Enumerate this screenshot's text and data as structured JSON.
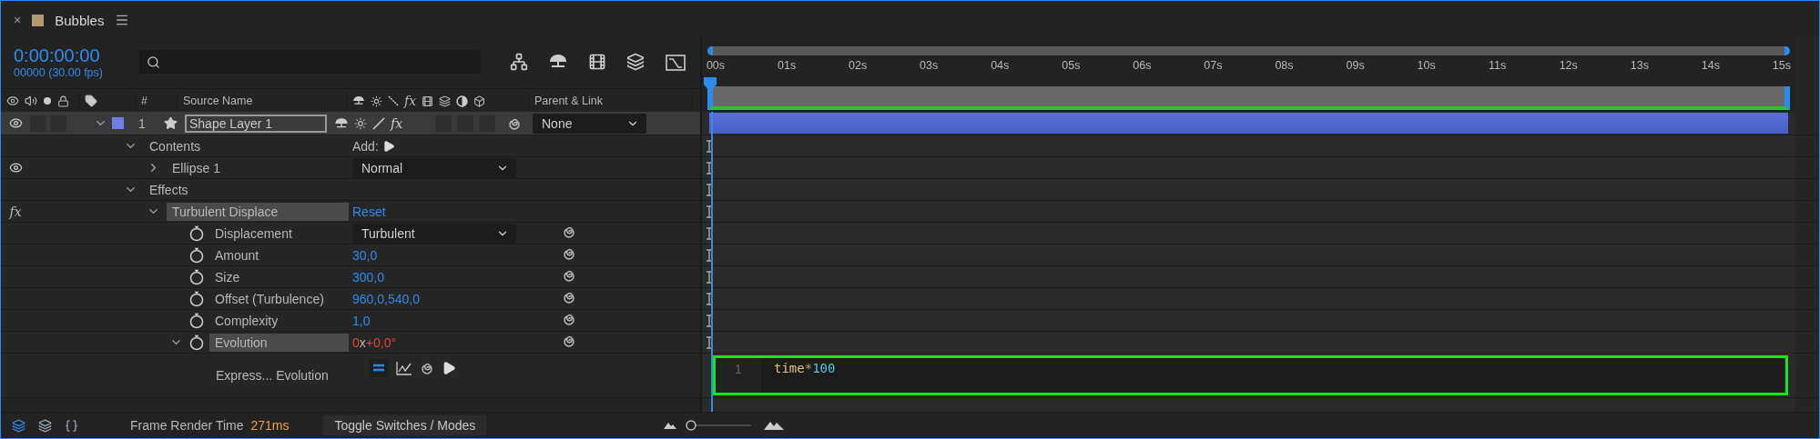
{
  "panel": {
    "close": "×",
    "title": "Bubbles"
  },
  "timecode": "0:00:00:00",
  "frames": "00000 (30.00 fps)",
  "columns": {
    "number": "#",
    "source": "Source Name",
    "switch_fx": "fx",
    "parent": "Parent & Link"
  },
  "layer": {
    "number": "1",
    "name": "Shape Layer 1",
    "expanded": true,
    "visible": true,
    "switch_fx": "fx",
    "fx_on": true,
    "parent": "None",
    "children": [
      {
        "kind": "group",
        "label": "Contents",
        "expanded": true,
        "add": "Add:",
        "children": [
          {
            "kind": "shape",
            "label": "Ellipse 1",
            "expanded": false,
            "visible": true,
            "mode": "Normal"
          }
        ]
      },
      {
        "kind": "group",
        "label": "Effects",
        "expanded": true,
        "children": [
          {
            "kind": "effect",
            "label": "Turbulent Displace",
            "badge": "fx",
            "expanded": true,
            "reset": "Reset",
            "children": [
              {
                "kind": "dropdown",
                "label": "Displacement",
                "value": "Turbulent"
              },
              {
                "kind": "number",
                "label": "Amount",
                "value": "30,0"
              },
              {
                "kind": "number",
                "label": "Size",
                "value": "300,0"
              },
              {
                "kind": "number",
                "label": "Offset (Turbulence)",
                "value": "960,0,540,0"
              },
              {
                "kind": "number",
                "label": "Complexity",
                "value": "1,0"
              },
              {
                "kind": "angle",
                "label": "Evolution",
                "expanded": true,
                "revolutions": "0",
                "separator": "x",
                "degrees": "+0,0°",
                "children": [
                  {
                    "kind": "expression",
                    "label": "Express... Evolution"
                  }
                ]
              }
            ]
          }
        ]
      }
    ]
  },
  "ruler": [
    "00s",
    "01s",
    "02s",
    "03s",
    "04s",
    "05s",
    "06s",
    "07s",
    "08s",
    "09s",
    "10s",
    "11s",
    "12s",
    "13s",
    "14s",
    "15s"
  ],
  "expression": {
    "line": "1",
    "tokens": [
      {
        "kind": "name",
        "text": "time"
      },
      {
        "kind": "operator",
        "text": "*"
      },
      {
        "kind": "number",
        "text": "100"
      }
    ]
  },
  "zoom": {
    "level": 0
  },
  "status": {
    "label": "Frame Render Time",
    "value": "271ms",
    "toggle": "Toggle Switches / Modes"
  }
}
